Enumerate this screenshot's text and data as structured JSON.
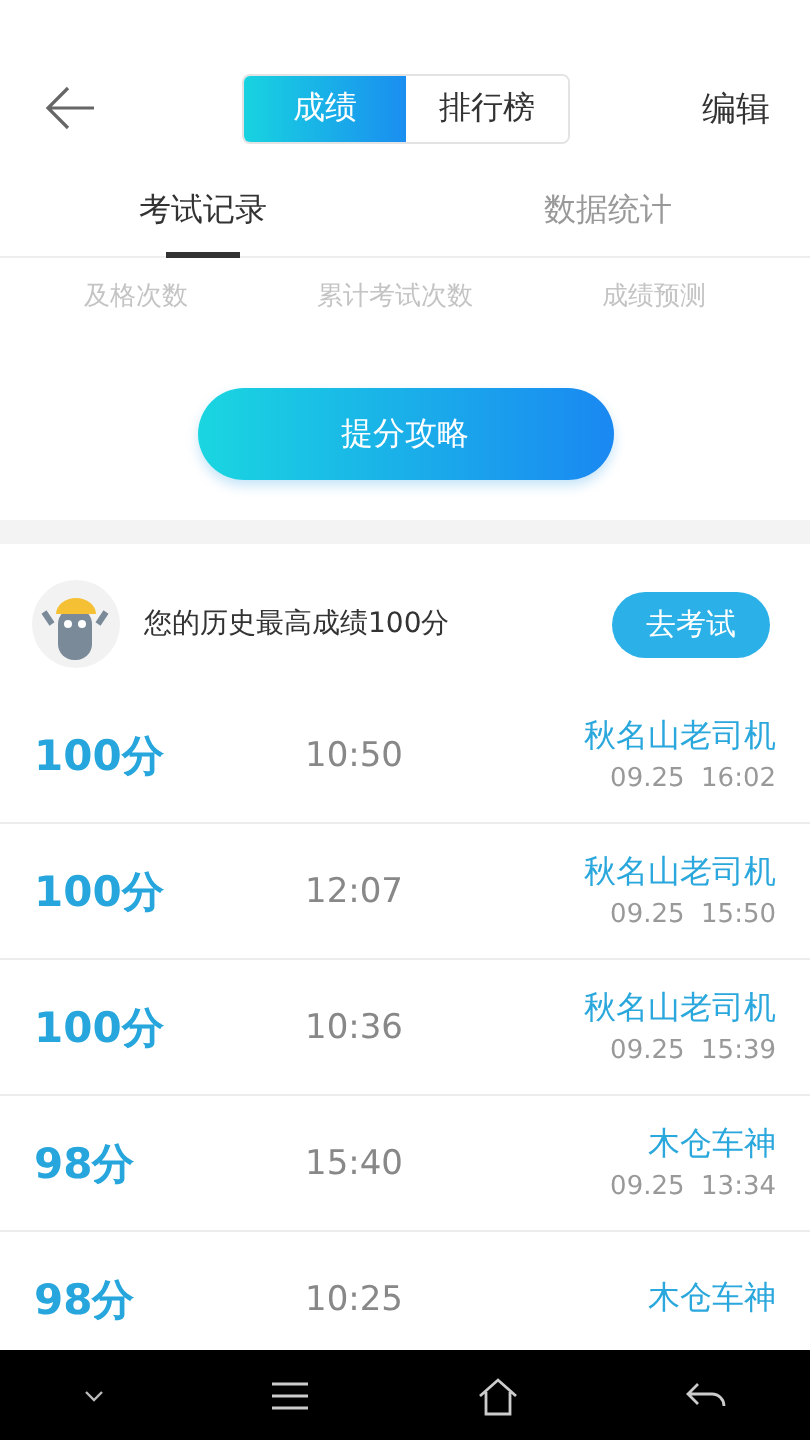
{
  "header": {
    "segments": [
      {
        "label": "成绩",
        "selected": true
      },
      {
        "label": "排行榜",
        "selected": false
      }
    ],
    "action": "编辑"
  },
  "tabs": [
    {
      "label": "考试记录",
      "selected": true
    },
    {
      "label": "数据统计",
      "selected": false
    }
  ],
  "stats": [
    "及格次数",
    "累计考试次数",
    "成绩预测"
  ],
  "tips_button": "提分攻略",
  "best": {
    "text": "您的历史最高成绩100分",
    "button": "去考试"
  },
  "records": [
    {
      "score": "100分",
      "duration": "10:50",
      "name": "秋名山老司机",
      "date": "09.25  16:02"
    },
    {
      "score": "100分",
      "duration": "12:07",
      "name": "秋名山老司机",
      "date": "09.25  15:50"
    },
    {
      "score": "100分",
      "duration": "10:36",
      "name": "秋名山老司机",
      "date": "09.25  15:39"
    },
    {
      "score": "98分",
      "duration": "15:40",
      "name": "木仓车神",
      "date": "09.25  13:34"
    },
    {
      "score": "98分",
      "duration": "10:25",
      "name": "木仓车神"
    }
  ]
}
